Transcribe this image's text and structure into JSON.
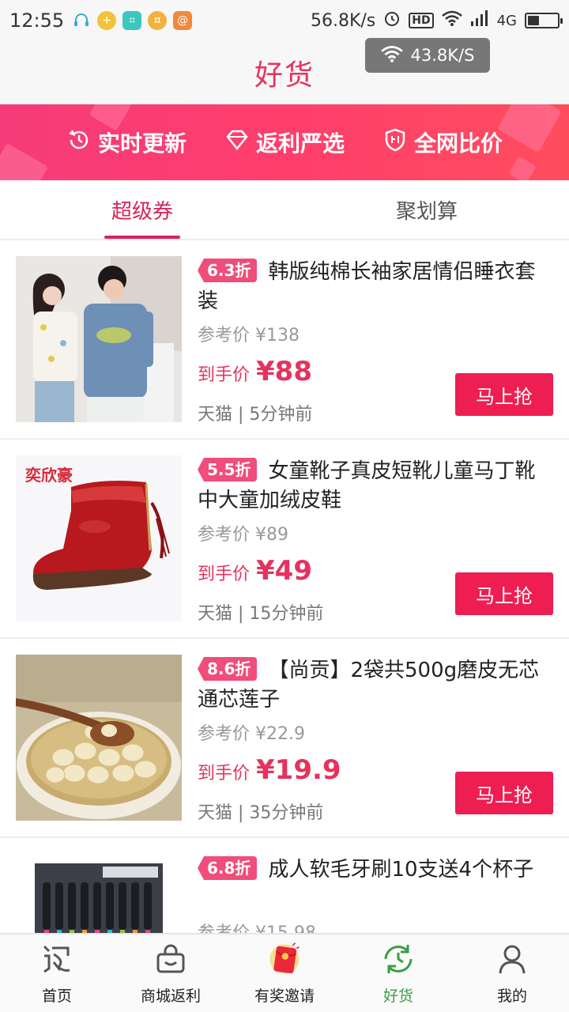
{
  "status_bar": {
    "time": "12:55",
    "speed": "56.8K/s",
    "network": "4G",
    "battery_level": 0.4,
    "hd_label": "HD"
  },
  "header": {
    "title": "好货",
    "speed_toast": "43.8K/S"
  },
  "banner": {
    "items": [
      {
        "label": "实时更新",
        "icon": "clock-refresh-icon"
      },
      {
        "label": "返利严选",
        "icon": "diamond-icon"
      },
      {
        "label": "全网比价",
        "icon": "shield-price-icon"
      }
    ]
  },
  "tabs": [
    {
      "label": "超级券",
      "active": true
    },
    {
      "label": "聚划算",
      "active": false
    }
  ],
  "products": [
    {
      "discount": "6.3折",
      "title": "韩版纯棉长袖家居情侣睡衣套装",
      "ref_price": "参考价 ¥138",
      "deal_label": "到手价",
      "deal_price": "¥88",
      "meta": "天猫 | 5分钟前",
      "button": "马上抢"
    },
    {
      "discount": "5.5折",
      "title": "女童靴子真皮短靴儿童马丁靴中大童加绒皮鞋",
      "ref_price": "参考价 ¥89",
      "deal_label": "到手价",
      "deal_price": "¥49",
      "meta": "天猫 | 15分钟前",
      "button": "马上抢",
      "brand": "奕欣豪"
    },
    {
      "discount": "8.6折",
      "title": "【尚贡】2袋共500g磨皮无芯通芯莲子",
      "ref_price": "参考价 ¥22.9",
      "deal_label": "到手价",
      "deal_price": "¥19.9",
      "meta": "天猫 | 35分钟前",
      "button": "马上抢"
    },
    {
      "discount": "6.8折",
      "title": "成人软毛牙刷10支送4个杯子",
      "ref_price": "参考价 ¥15.98",
      "deal_label": "",
      "deal_price": "",
      "meta": "",
      "button": ""
    }
  ],
  "bottom_nav": [
    {
      "label": "首页",
      "icon": "return-logo-icon",
      "active": false
    },
    {
      "label": "商城返利",
      "icon": "shopping-bag-icon",
      "active": false
    },
    {
      "label": "有奖邀请",
      "icon": "red-envelope-icon",
      "active": false
    },
    {
      "label": "好货",
      "icon": "refresh-clock-icon",
      "active": true
    },
    {
      "label": "我的",
      "icon": "person-icon",
      "active": false
    }
  ],
  "colors": {
    "accent": "#e4335e",
    "button": "#ee1d52",
    "active_nav": "#3a9c46"
  }
}
